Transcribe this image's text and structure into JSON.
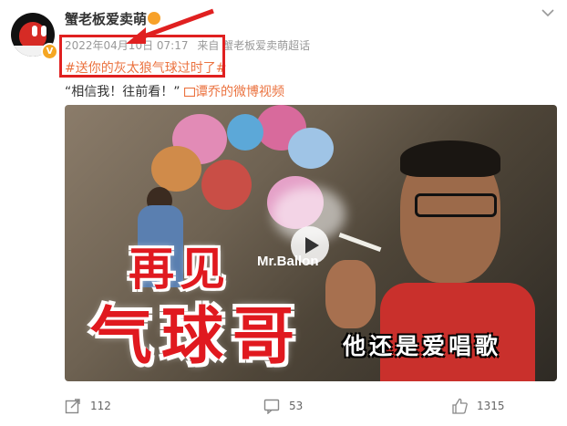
{
  "post": {
    "username": "蟹老板爱卖萌",
    "timestamp": "2022年04月10日 07:17",
    "source": "来自 蟹老板爱卖萌超话",
    "topic": "#送你的灰太狼气球过时了#",
    "text": "“相信我！往前看！”",
    "video_link": "谭乔的微博视频"
  },
  "video": {
    "brand": "Mr.Ballon",
    "title_line1": "再见",
    "title_line2": "气球哥",
    "caption": "他还是爱唱歌"
  },
  "actions": {
    "reposts": "112",
    "comments": "53",
    "likes": "1315"
  },
  "icons": {
    "more": "chevron-down-icon",
    "repost": "share-icon",
    "comment": "comment-icon",
    "like": "thumbs-up-icon",
    "play": "play-icon",
    "verified": "verified-badge-icon",
    "video": "video-icon"
  },
  "colors": {
    "accent": "#eb7340",
    "annotation": "#e02020",
    "headline": "#e0191f"
  }
}
